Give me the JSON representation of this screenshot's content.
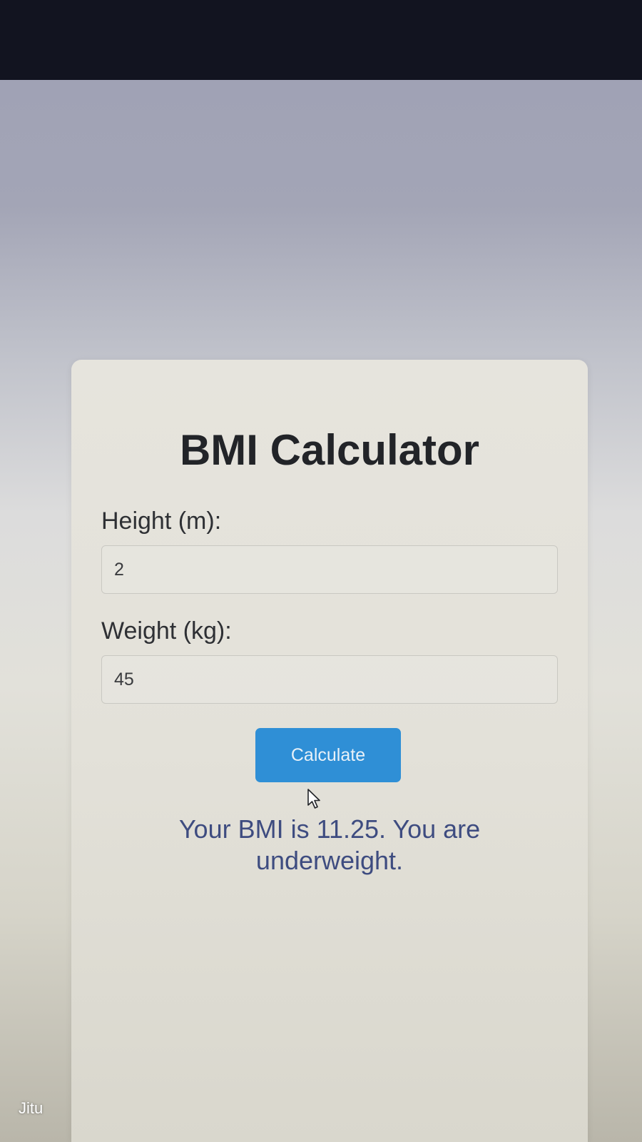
{
  "app": {
    "title": "BMI Calculator"
  },
  "form": {
    "height_label": "Height (m):",
    "height_value": "2",
    "weight_label": "Weight (kg):",
    "weight_value": "45",
    "calculate_label": "Calculate"
  },
  "result": {
    "text": "Your BMI is 11.25. You are underweight."
  },
  "watermark": {
    "text": "Jitu"
  },
  "colors": {
    "button": "#2f8fd6",
    "result_text": "#3e4c80",
    "title_text": "#222428"
  },
  "icons": {
    "cursor": "mouse-pointer-icon"
  }
}
